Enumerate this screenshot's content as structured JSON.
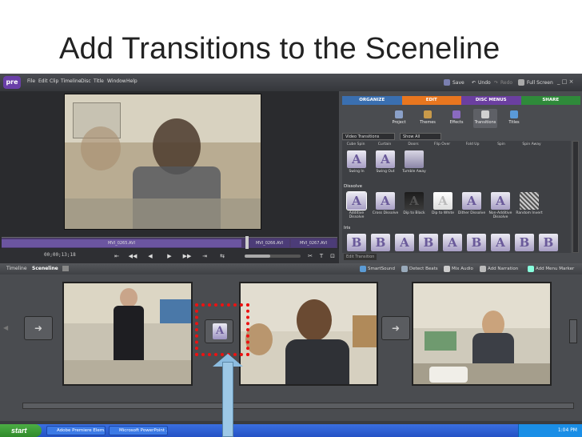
{
  "slide": {
    "title": "Add Transitions to the Sceneline"
  },
  "app": {
    "logo": "pre",
    "menu": [
      "File",
      "Edit",
      "Clip",
      "Timeline",
      "Disc",
      "Title",
      "Window",
      "Help"
    ],
    "top_buttons": {
      "save": "Save",
      "undo": "Undo",
      "redo": "Redo",
      "full_screen": "Full Screen"
    },
    "window_controls": "_ □ ×"
  },
  "tasks": {
    "tabs": [
      "ORGANIZE",
      "EDIT",
      "DISC MENUS",
      "SHARE"
    ],
    "tab_colors": [
      "#3a6fb0",
      "#e8761f",
      "#6b3fa0",
      "#2f8a3a"
    ],
    "tools": [
      "Project",
      "Themes",
      "Effects",
      "Transitions",
      "Titles"
    ],
    "category_dropdown": "Video Transitions",
    "filter_dropdown": "Show All",
    "top_row_labels": [
      "Cube Spin",
      "Curtain",
      "Doors",
      "Flip Over",
      "Fold Up",
      "Spin",
      "Spin Away"
    ],
    "row1": [
      {
        "glyph": "A",
        "label": "Swing In"
      },
      {
        "glyph": "A",
        "label": "Swing Out"
      },
      {
        "glyph": "",
        "label": "Tumble Away"
      }
    ],
    "dissolve_label": "Dissolve",
    "dissolve": [
      {
        "glyph": "A",
        "label": "Additive Dissolve"
      },
      {
        "glyph": "A",
        "label": "Cross Dissolve"
      },
      {
        "glyph": "A",
        "label": "Dip to Black"
      },
      {
        "glyph": "A",
        "label": "Dip to White"
      },
      {
        "glyph": "A",
        "label": "Dither Dissolve"
      },
      {
        "glyph": "A",
        "label": "Non-Additive Dissolve"
      },
      {
        "glyph": "",
        "label": "Random Invert"
      }
    ],
    "iris_label": "Iris",
    "iris_glyphs": [
      "B",
      "B",
      "A",
      "B",
      "A",
      "B",
      "A",
      "B",
      "B"
    ],
    "edit_transition": "Edit Transition"
  },
  "monitor": {
    "clips": [
      "MVI_0265.AVI",
      "MVI_0266.AVI",
      "MVI_0267.AVI"
    ],
    "timecode": "00;00;13;18",
    "controls": [
      "⇤",
      "◀◀",
      "◀",
      "▶",
      "▶▶",
      "⇥",
      "⇆"
    ],
    "tools": [
      "✂",
      "T",
      "⊡"
    ]
  },
  "sceneline_bar": {
    "tabs": [
      "Timeline",
      "Sceneline"
    ],
    "tools": [
      "SmartSound",
      "Detect Beats",
      "Mix Audio",
      "Add Narration",
      "Add Menu Marker"
    ]
  },
  "sceneline": {
    "left_arrow": "➜",
    "middle_arrow": "➜",
    "transition_glyph": "A"
  },
  "taskbar": {
    "start": "start",
    "items": [
      "Adobe Premiere Elem...",
      "Microsoft PowerPoint ..."
    ],
    "clock": "1:04 PM"
  }
}
